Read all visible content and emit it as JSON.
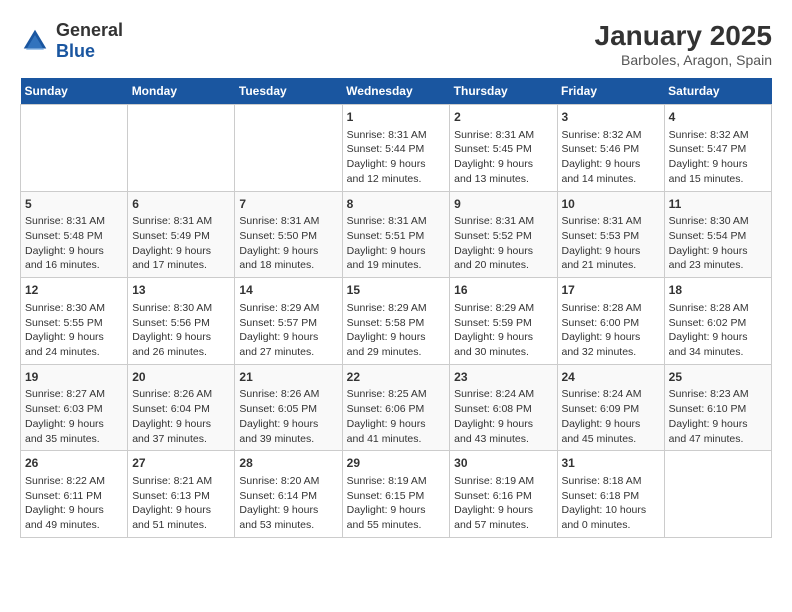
{
  "logo": {
    "general": "General",
    "blue": "Blue"
  },
  "title": "January 2025",
  "subtitle": "Barboles, Aragon, Spain",
  "days_of_week": [
    "Sunday",
    "Monday",
    "Tuesday",
    "Wednesday",
    "Thursday",
    "Friday",
    "Saturday"
  ],
  "weeks": [
    [
      {
        "day": "",
        "info": ""
      },
      {
        "day": "",
        "info": ""
      },
      {
        "day": "",
        "info": ""
      },
      {
        "day": "1",
        "sunrise": "Sunrise: 8:31 AM",
        "sunset": "Sunset: 5:44 PM",
        "daylight": "Daylight: 9 hours and 12 minutes."
      },
      {
        "day": "2",
        "sunrise": "Sunrise: 8:31 AM",
        "sunset": "Sunset: 5:45 PM",
        "daylight": "Daylight: 9 hours and 13 minutes."
      },
      {
        "day": "3",
        "sunrise": "Sunrise: 8:32 AM",
        "sunset": "Sunset: 5:46 PM",
        "daylight": "Daylight: 9 hours and 14 minutes."
      },
      {
        "day": "4",
        "sunrise": "Sunrise: 8:32 AM",
        "sunset": "Sunset: 5:47 PM",
        "daylight": "Daylight: 9 hours and 15 minutes."
      }
    ],
    [
      {
        "day": "5",
        "sunrise": "Sunrise: 8:31 AM",
        "sunset": "Sunset: 5:48 PM",
        "daylight": "Daylight: 9 hours and 16 minutes."
      },
      {
        "day": "6",
        "sunrise": "Sunrise: 8:31 AM",
        "sunset": "Sunset: 5:49 PM",
        "daylight": "Daylight: 9 hours and 17 minutes."
      },
      {
        "day": "7",
        "sunrise": "Sunrise: 8:31 AM",
        "sunset": "Sunset: 5:50 PM",
        "daylight": "Daylight: 9 hours and 18 minutes."
      },
      {
        "day": "8",
        "sunrise": "Sunrise: 8:31 AM",
        "sunset": "Sunset: 5:51 PM",
        "daylight": "Daylight: 9 hours and 19 minutes."
      },
      {
        "day": "9",
        "sunrise": "Sunrise: 8:31 AM",
        "sunset": "Sunset: 5:52 PM",
        "daylight": "Daylight: 9 hours and 20 minutes."
      },
      {
        "day": "10",
        "sunrise": "Sunrise: 8:31 AM",
        "sunset": "Sunset: 5:53 PM",
        "daylight": "Daylight: 9 hours and 21 minutes."
      },
      {
        "day": "11",
        "sunrise": "Sunrise: 8:30 AM",
        "sunset": "Sunset: 5:54 PM",
        "daylight": "Daylight: 9 hours and 23 minutes."
      }
    ],
    [
      {
        "day": "12",
        "sunrise": "Sunrise: 8:30 AM",
        "sunset": "Sunset: 5:55 PM",
        "daylight": "Daylight: 9 hours and 24 minutes."
      },
      {
        "day": "13",
        "sunrise": "Sunrise: 8:30 AM",
        "sunset": "Sunset: 5:56 PM",
        "daylight": "Daylight: 9 hours and 26 minutes."
      },
      {
        "day": "14",
        "sunrise": "Sunrise: 8:29 AM",
        "sunset": "Sunset: 5:57 PM",
        "daylight": "Daylight: 9 hours and 27 minutes."
      },
      {
        "day": "15",
        "sunrise": "Sunrise: 8:29 AM",
        "sunset": "Sunset: 5:58 PM",
        "daylight": "Daylight: 9 hours and 29 minutes."
      },
      {
        "day": "16",
        "sunrise": "Sunrise: 8:29 AM",
        "sunset": "Sunset: 5:59 PM",
        "daylight": "Daylight: 9 hours and 30 minutes."
      },
      {
        "day": "17",
        "sunrise": "Sunrise: 8:28 AM",
        "sunset": "Sunset: 6:00 PM",
        "daylight": "Daylight: 9 hours and 32 minutes."
      },
      {
        "day": "18",
        "sunrise": "Sunrise: 8:28 AM",
        "sunset": "Sunset: 6:02 PM",
        "daylight": "Daylight: 9 hours and 34 minutes."
      }
    ],
    [
      {
        "day": "19",
        "sunrise": "Sunrise: 8:27 AM",
        "sunset": "Sunset: 6:03 PM",
        "daylight": "Daylight: 9 hours and 35 minutes."
      },
      {
        "day": "20",
        "sunrise": "Sunrise: 8:26 AM",
        "sunset": "Sunset: 6:04 PM",
        "daylight": "Daylight: 9 hours and 37 minutes."
      },
      {
        "day": "21",
        "sunrise": "Sunrise: 8:26 AM",
        "sunset": "Sunset: 6:05 PM",
        "daylight": "Daylight: 9 hours and 39 minutes."
      },
      {
        "day": "22",
        "sunrise": "Sunrise: 8:25 AM",
        "sunset": "Sunset: 6:06 PM",
        "daylight": "Daylight: 9 hours and 41 minutes."
      },
      {
        "day": "23",
        "sunrise": "Sunrise: 8:24 AM",
        "sunset": "Sunset: 6:08 PM",
        "daylight": "Daylight: 9 hours and 43 minutes."
      },
      {
        "day": "24",
        "sunrise": "Sunrise: 8:24 AM",
        "sunset": "Sunset: 6:09 PM",
        "daylight": "Daylight: 9 hours and 45 minutes."
      },
      {
        "day": "25",
        "sunrise": "Sunrise: 8:23 AM",
        "sunset": "Sunset: 6:10 PM",
        "daylight": "Daylight: 9 hours and 47 minutes."
      }
    ],
    [
      {
        "day": "26",
        "sunrise": "Sunrise: 8:22 AM",
        "sunset": "Sunset: 6:11 PM",
        "daylight": "Daylight: 9 hours and 49 minutes."
      },
      {
        "day": "27",
        "sunrise": "Sunrise: 8:21 AM",
        "sunset": "Sunset: 6:13 PM",
        "daylight": "Daylight: 9 hours and 51 minutes."
      },
      {
        "day": "28",
        "sunrise": "Sunrise: 8:20 AM",
        "sunset": "Sunset: 6:14 PM",
        "daylight": "Daylight: 9 hours and 53 minutes."
      },
      {
        "day": "29",
        "sunrise": "Sunrise: 8:19 AM",
        "sunset": "Sunset: 6:15 PM",
        "daylight": "Daylight: 9 hours and 55 minutes."
      },
      {
        "day": "30",
        "sunrise": "Sunrise: 8:19 AM",
        "sunset": "Sunset: 6:16 PM",
        "daylight": "Daylight: 9 hours and 57 minutes."
      },
      {
        "day": "31",
        "sunrise": "Sunrise: 8:18 AM",
        "sunset": "Sunset: 6:18 PM",
        "daylight": "Daylight: 10 hours and 0 minutes."
      },
      {
        "day": "",
        "info": ""
      }
    ]
  ]
}
